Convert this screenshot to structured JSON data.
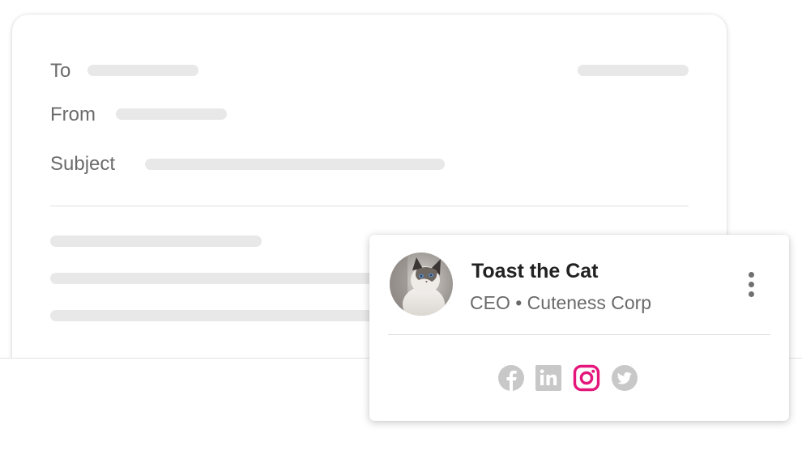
{
  "email": {
    "to_label": "To",
    "from_label": "From",
    "subject_label": "Subject"
  },
  "signature": {
    "name": "Toast the Cat",
    "title": "CEO • Cuteness Corp",
    "avatar_icon": "cat-photo",
    "menu_icon": "more-vertical-icon",
    "social_links": [
      {
        "name": "facebook-icon",
        "color": "#c8c8c8"
      },
      {
        "name": "linkedin-icon",
        "color": "#c8c8c8"
      },
      {
        "name": "instagram-icon",
        "color": "#e4157b"
      },
      {
        "name": "twitter-icon",
        "color": "#c8c8c8"
      }
    ]
  },
  "colors": {
    "placeholder": "#e8e8e8",
    "instagram_active": "#e4157b",
    "social_inactive": "#c8c8c8"
  }
}
